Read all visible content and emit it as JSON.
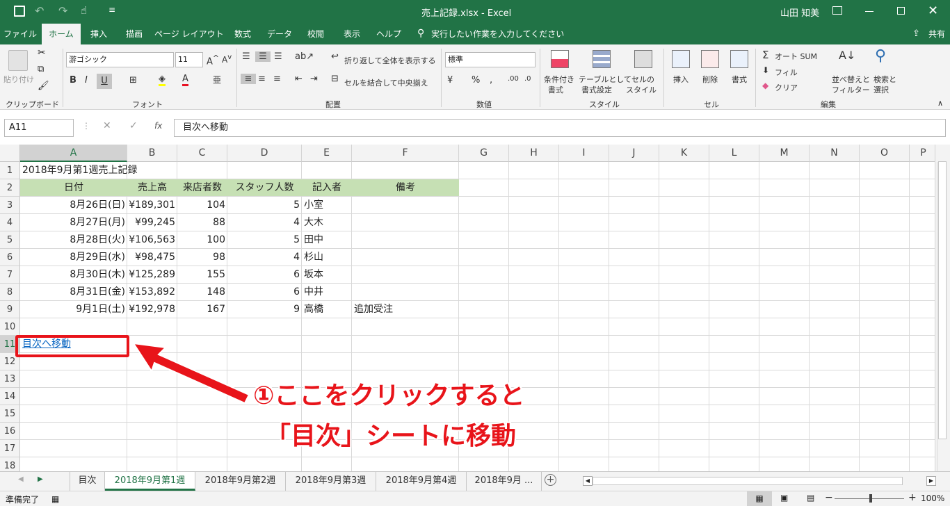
{
  "titlebar": {
    "title": "売上記録.xlsx  -  Excel",
    "user": "山田 知美"
  },
  "tabs": [
    "ファイル",
    "ホーム",
    "挿入",
    "描画",
    "ページ レイアウト",
    "数式",
    "データ",
    "校閲",
    "表示",
    "ヘルプ"
  ],
  "tell_me": "実行したい作業を入力してください",
  "share": "共有",
  "ribbon": {
    "clipboard": {
      "paste": "貼り付け",
      "group": "クリップボード"
    },
    "font": {
      "name": "游ゴシック",
      "size": "11",
      "group": "フォント"
    },
    "alignment": {
      "wrap": "折り返して全体を表示する",
      "merge": "セルを結合して中央揃え",
      "group": "配置"
    },
    "number": {
      "format": "標準",
      "group": "数値"
    },
    "styles": {
      "cond1": "条件付き",
      "cond2": "書式",
      "table1": "テーブルとして",
      "table2": "書式設定",
      "cell1": "セルの",
      "cell2": "スタイル",
      "group": "スタイル"
    },
    "cells": {
      "insert": "挿入",
      "delete": "削除",
      "format": "書式",
      "group": "セル"
    },
    "editing": {
      "autosum": "オート SUM",
      "fill": "フィル",
      "clear": "クリア",
      "sort1": "並べ替えと",
      "sort2": "フィルター",
      "find1": "検索と",
      "find2": "選択",
      "group": "編集"
    }
  },
  "formula_bar": {
    "name_box": "A11",
    "fx": "fx",
    "content": "目次へ移動"
  },
  "columns": [
    "A",
    "B",
    "C",
    "D",
    "E",
    "F",
    "G",
    "H",
    "I",
    "J",
    "K",
    "L",
    "M",
    "N",
    "O",
    "P"
  ],
  "rows": [
    "1",
    "2",
    "3",
    "4",
    "5",
    "6",
    "7",
    "8",
    "9",
    "10",
    "11",
    "12",
    "13",
    "14",
    "15",
    "16",
    "17",
    "18"
  ],
  "sheet": {
    "title": "2018年9月第1週売上記録",
    "headers": [
      "日付",
      "売上高",
      "来店者数",
      "スタッフ人数",
      "記入者",
      "備考"
    ],
    "data": [
      [
        "8月26日(日)",
        "¥189,301",
        "104",
        "5",
        "小室",
        ""
      ],
      [
        "8月27日(月)",
        "¥99,245",
        "88",
        "4",
        "大木",
        ""
      ],
      [
        "8月28日(火)",
        "¥106,563",
        "100",
        "5",
        "田中",
        ""
      ],
      [
        "8月29日(水)",
        "¥98,475",
        "98",
        "4",
        "杉山",
        ""
      ],
      [
        "8月30日(木)",
        "¥125,289",
        "155",
        "6",
        "坂本",
        ""
      ],
      [
        "8月31日(金)",
        "¥153,892",
        "148",
        "6",
        "中井",
        ""
      ],
      [
        "9月1日(土)",
        "¥192,978",
        "167",
        "9",
        "高橋",
        "追加受注"
      ]
    ],
    "link": "目次へ移動"
  },
  "sheet_tabs": [
    "目次",
    "2018年9月第1週",
    "2018年9月第2週",
    "2018年9月第3週",
    "2018年9月第4週",
    "2018年9月 ..."
  ],
  "status": {
    "ready": "準備完了",
    "zoom": "100%"
  },
  "annotation": {
    "line1": "①ここをクリックすると",
    "line2": "「目次」シートに移動"
  },
  "colors": {
    "accent": "#217346",
    "header_fill": "#c6e0b4",
    "annotation": "#e8141a",
    "link": "#0563c1"
  }
}
